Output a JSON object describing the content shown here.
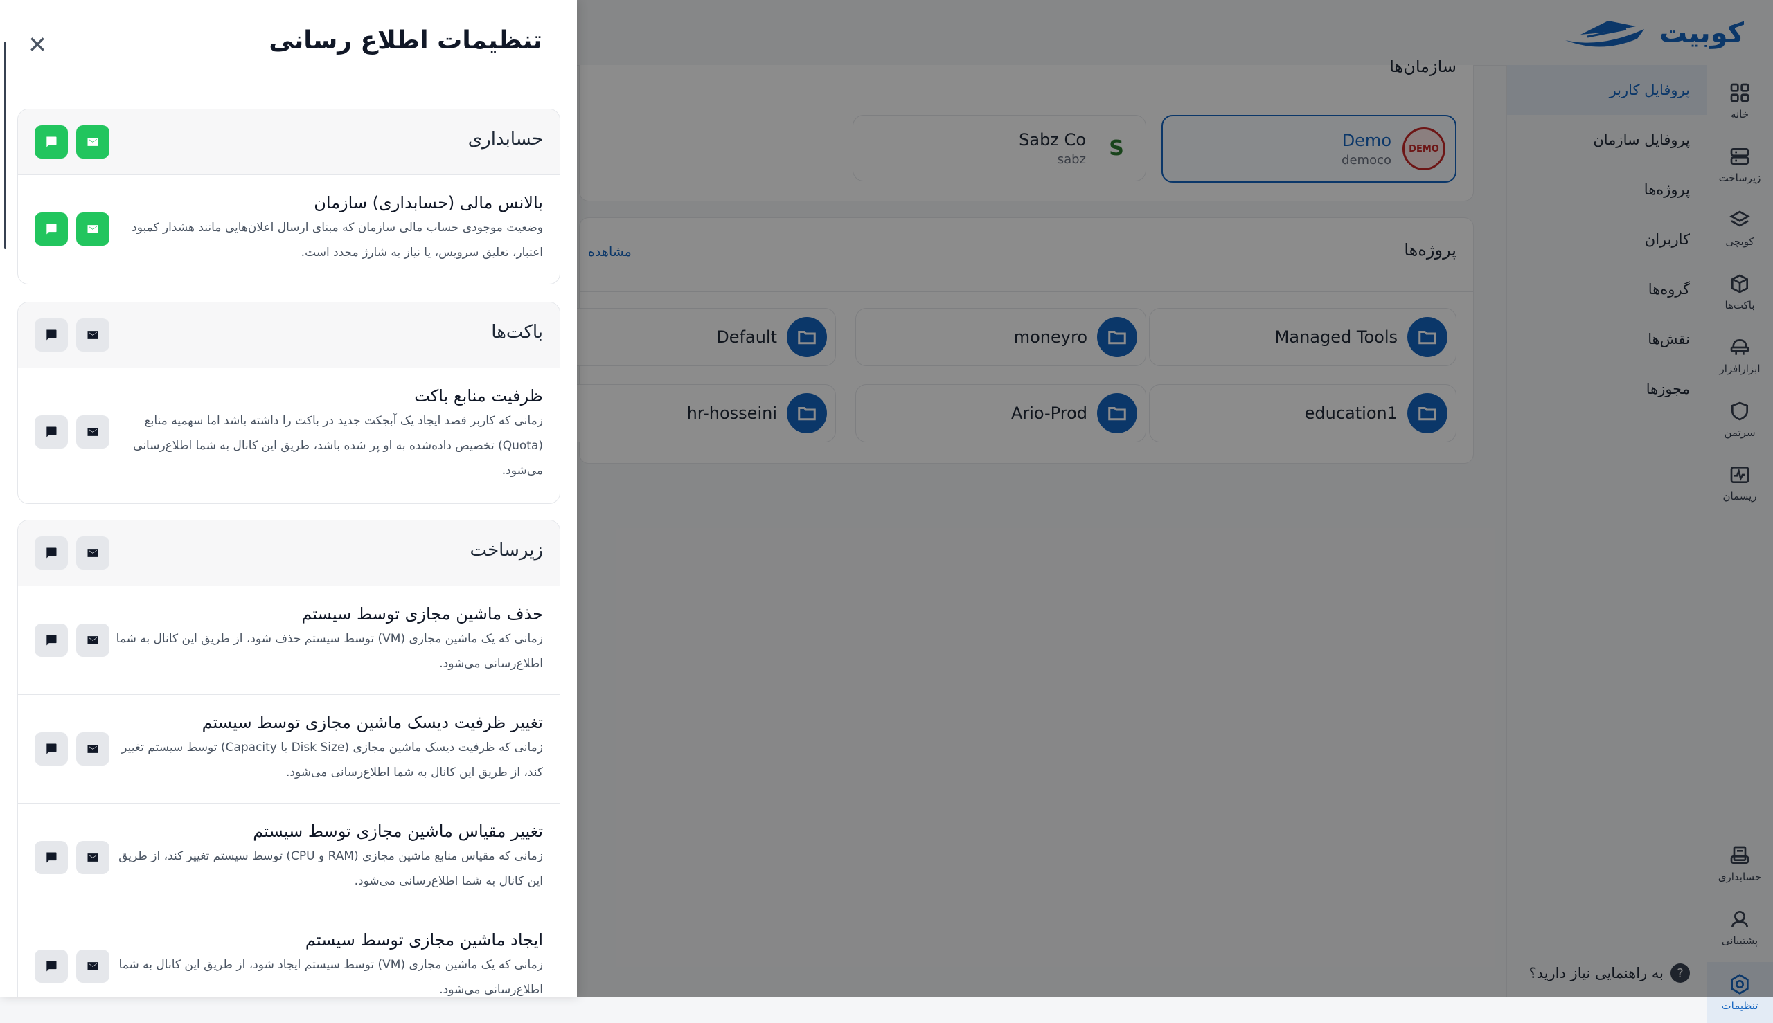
{
  "brand": {
    "name": "کوبیت"
  },
  "rail": [
    {
      "label": "خانه",
      "icon": "grid-icon"
    },
    {
      "label": "زیرساخت",
      "icon": "server-icon"
    },
    {
      "label": "کوبچی",
      "icon": "layers-icon"
    },
    {
      "label": "باکت‌ها",
      "icon": "box-icon"
    },
    {
      "label": "ابزارافزار",
      "icon": "tools-icon"
    },
    {
      "label": "سرتمن",
      "icon": "shield-icon"
    },
    {
      "label": "ریسمان",
      "icon": "pulse-icon"
    },
    {
      "label": "حسابداری",
      "icon": "invoice-icon"
    },
    {
      "label": "پشتیبانی",
      "icon": "support-icon"
    },
    {
      "label": "تنظیمات",
      "icon": "settings-icon"
    }
  ],
  "submenu": [
    {
      "label": "پروفایل کاربر"
    },
    {
      "label": "پروفایل سازمان"
    },
    {
      "label": "پروژه‌ها"
    },
    {
      "label": "کاربران"
    },
    {
      "label": "گروه‌ها"
    },
    {
      "label": "نقش‌ها"
    },
    {
      "label": "مجوزها"
    }
  ],
  "help": {
    "label": "به راهنمایی نیاز دارید؟",
    "icon": "?"
  },
  "organizations": {
    "title": "سازمان‌ها",
    "items": [
      {
        "name": "Demo",
        "slug": "democo",
        "logo_text": "DEMO"
      },
      {
        "name": "Sabz Co",
        "slug": "sabz",
        "logo_text": "S"
      }
    ]
  },
  "projects": {
    "title": "پروژه‌ها",
    "view_all": "مشاهده",
    "items": [
      {
        "name": "Managed Tools"
      },
      {
        "name": "moneyro"
      },
      {
        "name": "Default"
      },
      {
        "name": "education1"
      },
      {
        "name": "Ario-Prod"
      },
      {
        "name": "hr-hosseini"
      }
    ]
  },
  "drawer": {
    "title": "تنظیمات اطلاع رسانی",
    "groups": [
      {
        "title": "حسابداری",
        "email_on": true,
        "sms_on": true,
        "items": [
          {
            "title": "بالانس مالی (حسابداری) سازمان",
            "desc_lines": [
              "وضعیت موجودی حساب مالی سازمان که مبنای ارسال اعلان‌هایی مانند هشدار کمبود",
              "اعتبار، تعلیق سرویس، یا نیاز به شارژ مجدد است."
            ],
            "email_on": true,
            "sms_on": true
          }
        ]
      },
      {
        "title": "باکت‌ها",
        "email_on": false,
        "sms_on": false,
        "items": [
          {
            "title": "ظرفیت منابع باکت",
            "desc_lines": [
              "زمانی که کاربر قصد ایجاد یک آبجکت جدید در باکت را داشته باشد اما سهمیه منابع",
              "(Quota) تخصیص داده‌شده به او پر شده باشد، طریق این کانال به شما اطلاع‌رسانی",
              "می‌شود."
            ],
            "email_on": false,
            "sms_on": false
          }
        ]
      },
      {
        "title": "زیرساخت",
        "email_on": false,
        "sms_on": false,
        "items": [
          {
            "title": "حذف ماشین مجازی توسط سیستم",
            "desc_lines": [
              "زمانی که یک ماشین مجازی (VM) توسط سیستم حذف شود، از طریق این کانال به شما",
              "اطلاع‌رسانی می‌شود."
            ],
            "email_on": false,
            "sms_on": false
          },
          {
            "title": "تغییر ظرفیت دیسک ماشین مجازی توسط سیستم",
            "desc_lines": [
              "زمانی که ظرفیت دیسک ماشین مجازی (Disk Size یا Capacity) توسط سیستم تغییر",
              "کند، از طریق این کانال به شما اطلاع‌رسانی می‌شود."
            ],
            "email_on": false,
            "sms_on": false
          },
          {
            "title": "تغییر مقیاس ماشین مجازی توسط سیستم",
            "desc_lines": [
              "زمانی که مقیاس منابع ماشین مجازی (RAM و CPU) توسط سیستم تغییر کند، از طریق",
              "این کانال به شما اطلاع‌رسانی می‌شود."
            ],
            "email_on": false,
            "sms_on": false
          },
          {
            "title": "ایجاد ماشین مجازی توسط سیستم",
            "desc_lines": [
              "زمانی که یک ماشین مجازی (VM) توسط سیستم ایجاد شود، از طریق این کانال به شما",
              "اطلاع‌رسانی می‌شود."
            ],
            "email_on": false,
            "sms_on": false
          }
        ]
      }
    ]
  }
}
